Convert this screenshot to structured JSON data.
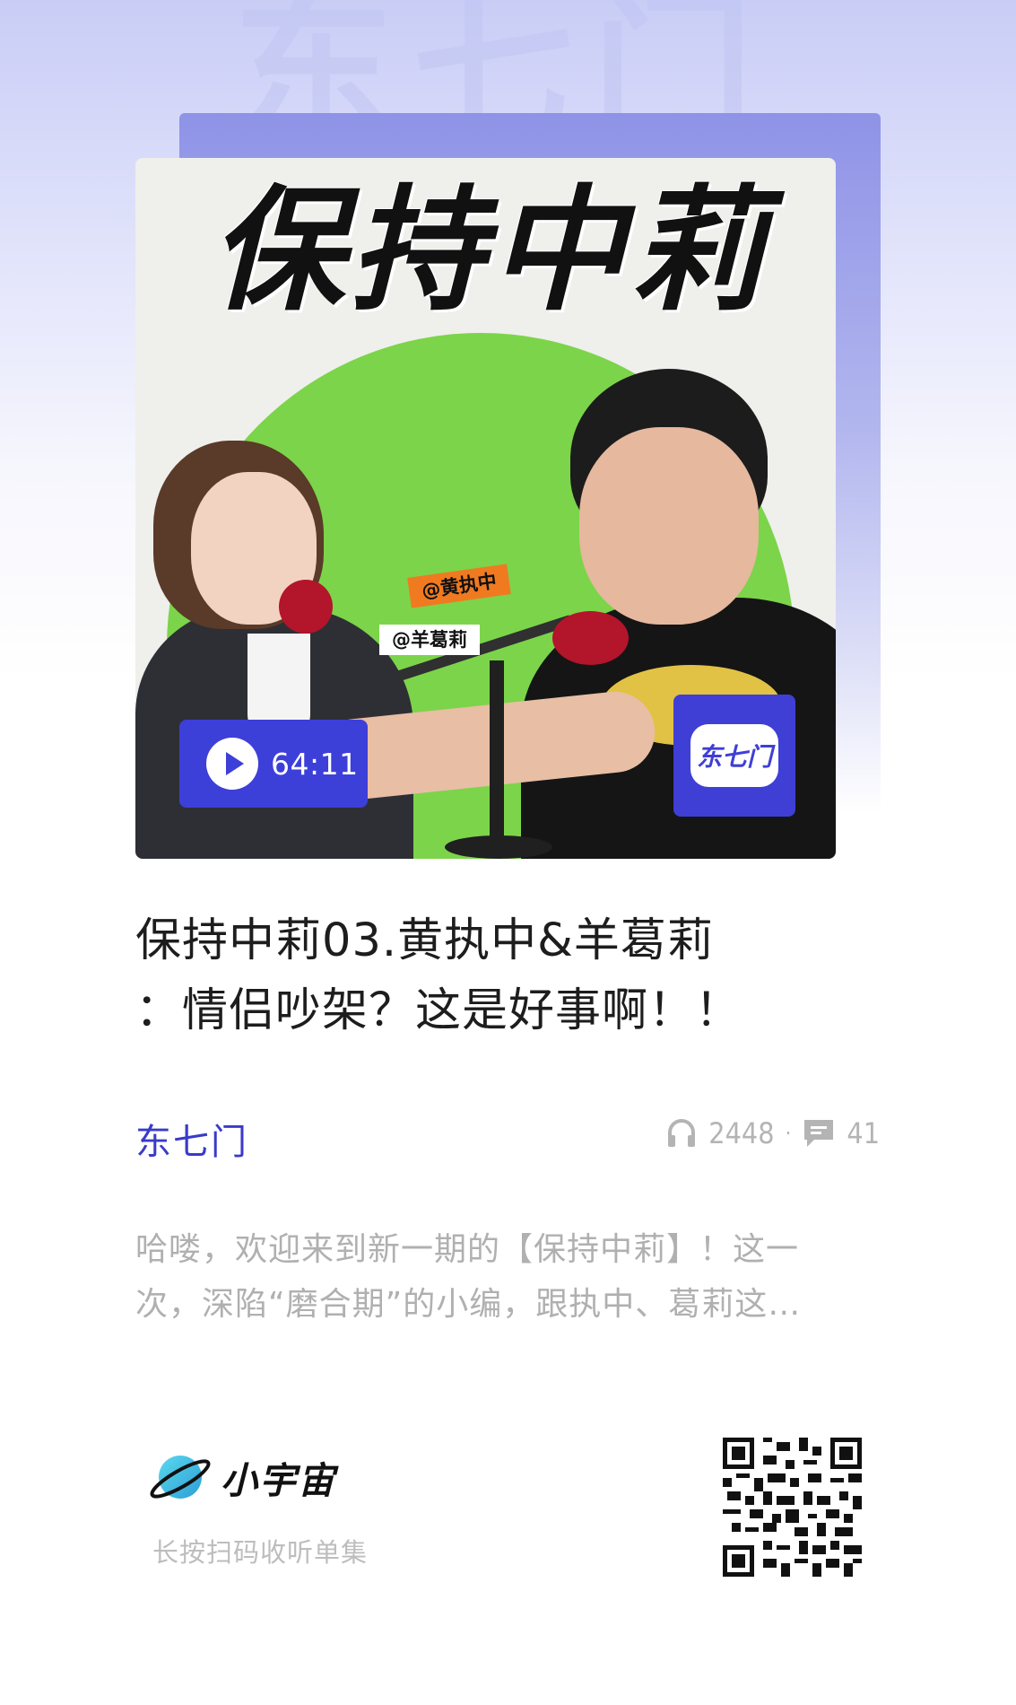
{
  "watermark_text": "东七门",
  "cover": {
    "title_art": "保持中莉",
    "tags": [
      "@黄执中",
      "@羊葛莉"
    ],
    "duration": "64:11",
    "badge_logo_text": "东七门"
  },
  "episode": {
    "title_line1": "保持中莉03.黄执中&羊葛莉",
    "title_line2": "：情侣吵架？这是好事啊！！"
  },
  "podcast": {
    "name": "东七门"
  },
  "stats": {
    "plays": "2448",
    "separator": "·",
    "comments": "41",
    "plays_icon": "headphones-icon",
    "comments_icon": "comment-icon"
  },
  "description": {
    "line1": "哈喽，欢迎来到新一期的【保持中莉】！这一",
    "line2": "次，深陷“磨合期”的小编，跟执中、葛莉这…"
  },
  "footer": {
    "brand_name": "小宇宙",
    "scan_hint": "长按扫码收听单集"
  },
  "colors": {
    "accent": "#3d3fd9",
    "green": "#7cd44a",
    "muted_text": "#b0b0b0"
  }
}
